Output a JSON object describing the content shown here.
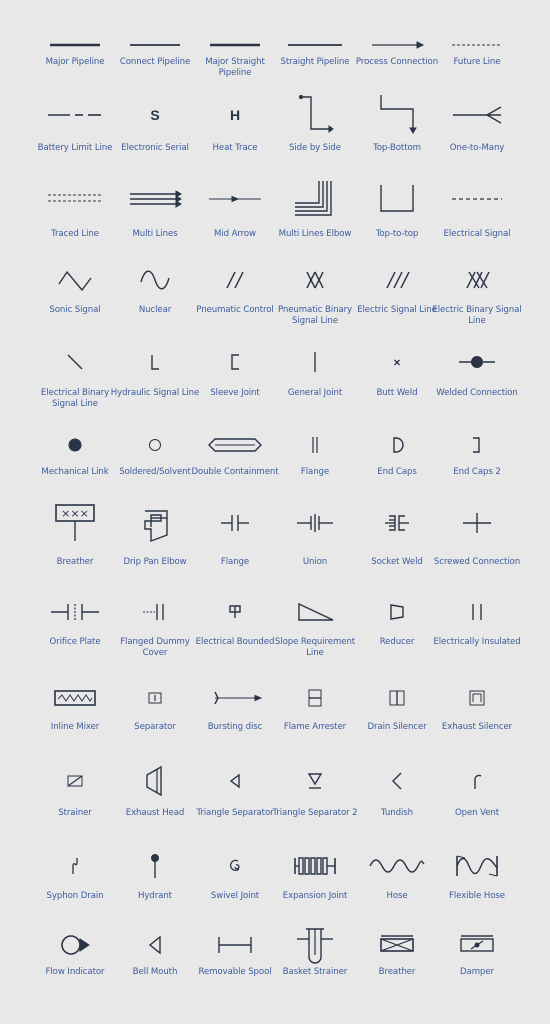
{
  "colors": {
    "background": "#e8e8e8",
    "symbol": "#2b3445",
    "label": "#3c5b9c"
  },
  "rows": [
    [
      {
        "label": "Major Pipeline",
        "icon": "major-pipeline"
      },
      {
        "label": "Connect Pipeline",
        "icon": "connect-pipeline"
      },
      {
        "label": "Major Straight Pipeline",
        "icon": "major-straight-pipeline"
      },
      {
        "label": "Straight Pipeline",
        "icon": "straight-pipeline"
      },
      {
        "label": "Process Connection",
        "icon": "process-connection"
      },
      {
        "label": "Future Line",
        "icon": "future-line"
      }
    ],
    [
      {
        "label": "Battery Limit Line",
        "icon": "battery-limit-line"
      },
      {
        "label": "Electronic Serial",
        "icon": "electronic-serial",
        "glyph": "S"
      },
      {
        "label": "Heat Trace",
        "icon": "heat-trace",
        "glyph": "H"
      },
      {
        "label": "Side by Side",
        "icon": "side-by-side"
      },
      {
        "label": "Top-Bottom",
        "icon": "top-bottom"
      },
      {
        "label": "One-to-Many",
        "icon": "one-to-many"
      }
    ],
    [
      {
        "label": "Traced Line",
        "icon": "traced-line"
      },
      {
        "label": "Multi Lines",
        "icon": "multi-lines"
      },
      {
        "label": "Mid Arrow",
        "icon": "mid-arrow"
      },
      {
        "label": "Multi Lines Elbow",
        "icon": "multi-lines-elbow"
      },
      {
        "label": "Top-to-top",
        "icon": "top-to-top"
      },
      {
        "label": "Electrical Signal",
        "icon": "electrical-signal"
      }
    ],
    [
      {
        "label": "Sonic Signal",
        "icon": "sonic-signal"
      },
      {
        "label": "Nuclear",
        "icon": "nuclear"
      },
      {
        "label": "Pneumatic Control",
        "icon": "pneumatic-control"
      },
      {
        "label": "Pneumatic Binary Signal Line",
        "icon": "pneumatic-binary"
      },
      {
        "label": "Electric Signal Line",
        "icon": "electric-signal-line"
      },
      {
        "label": "Electric Binary Signal Line",
        "icon": "electric-binary"
      }
    ],
    [
      {
        "label": "Electrical Binary Signal Line",
        "icon": "electrical-binary-signal"
      },
      {
        "label": "Hydraulic Signal Line",
        "icon": "hydraulic-signal"
      },
      {
        "label": "Sleeve Joint",
        "icon": "sleeve-joint"
      },
      {
        "label": "General Joint",
        "icon": "general-joint"
      },
      {
        "label": "Butt Weld",
        "icon": "butt-weld"
      },
      {
        "label": "Welded Connection",
        "icon": "welded-connection"
      }
    ],
    [
      {
        "label": "Mechanical Link",
        "icon": "mechanical-link"
      },
      {
        "label": "Soldered/Solvent",
        "icon": "soldered-solvent"
      },
      {
        "label": "Double Containment",
        "icon": "double-containment"
      },
      {
        "label": "Flange",
        "icon": "flange-double-line"
      },
      {
        "label": "End Caps",
        "icon": "end-caps"
      },
      {
        "label": "End Caps 2",
        "icon": "end-caps-2"
      }
    ],
    [
      {
        "label": "Breather",
        "icon": "breather-xxx",
        "glyph": "×××"
      },
      {
        "label": "Drip Pan Elbow",
        "icon": "drip-pan-elbow"
      },
      {
        "label": "Flange",
        "icon": "flange"
      },
      {
        "label": "Union",
        "icon": "union"
      },
      {
        "label": "Socket Weld",
        "icon": "socket-weld"
      },
      {
        "label": "Screwed Connection",
        "icon": "screwed-connection"
      }
    ],
    [
      {
        "label": "Orifice Plate",
        "icon": "orifice-plate"
      },
      {
        "label": "Flanged Dummy Cover",
        "icon": "flanged-dummy-cover"
      },
      {
        "label": "Electrical Bounded",
        "icon": "electrical-bounded"
      },
      {
        "label": "Slope Requirement Line",
        "icon": "slope-requirement"
      },
      {
        "label": "Reducer",
        "icon": "reducer"
      },
      {
        "label": "Electrically Insulated",
        "icon": "electrically-insulated"
      }
    ],
    [
      {
        "label": "Inline Mixer",
        "icon": "inline-mixer"
      },
      {
        "label": "Separator",
        "icon": "separator"
      },
      {
        "label": "Bursting disc",
        "icon": "bursting-disc"
      },
      {
        "label": "Flame Arrester",
        "icon": "flame-arrester"
      },
      {
        "label": "Drain Silencer",
        "icon": "drain-silencer"
      },
      {
        "label": "Exhaust Silencer",
        "icon": "exhaust-silencer"
      }
    ],
    [
      {
        "label": "Strainer",
        "icon": "strainer"
      },
      {
        "label": "Exhaust Head",
        "icon": "exhaust-head"
      },
      {
        "label": "Triangle Separator",
        "icon": "triangle-separator"
      },
      {
        "label": "Triangle Separator 2",
        "icon": "triangle-separator-2"
      },
      {
        "label": "Tundish",
        "icon": "tundish"
      },
      {
        "label": "Open Vent",
        "icon": "open-vent"
      }
    ],
    [
      {
        "label": "Syphon Drain",
        "icon": "syphon-drain"
      },
      {
        "label": "Hydrant",
        "icon": "hydrant"
      },
      {
        "label": "Swivel Joint",
        "icon": "swivel-joint"
      },
      {
        "label": "Expansion Joint",
        "icon": "expansion-joint"
      },
      {
        "label": "Hose",
        "icon": "hose"
      },
      {
        "label": "Flexible Hose",
        "icon": "flexible-hose"
      }
    ],
    [
      {
        "label": "Flow Indicator",
        "icon": "flow-indicator"
      },
      {
        "label": "Bell Mouth",
        "icon": "bell-mouth"
      },
      {
        "label": "Removable Spool",
        "icon": "removable-spool"
      },
      {
        "label": "Basket Strainer",
        "icon": "basket-strainer"
      },
      {
        "label": "Breather",
        "icon": "breather-box"
      },
      {
        "label": "Damper",
        "icon": "damper"
      }
    ]
  ]
}
